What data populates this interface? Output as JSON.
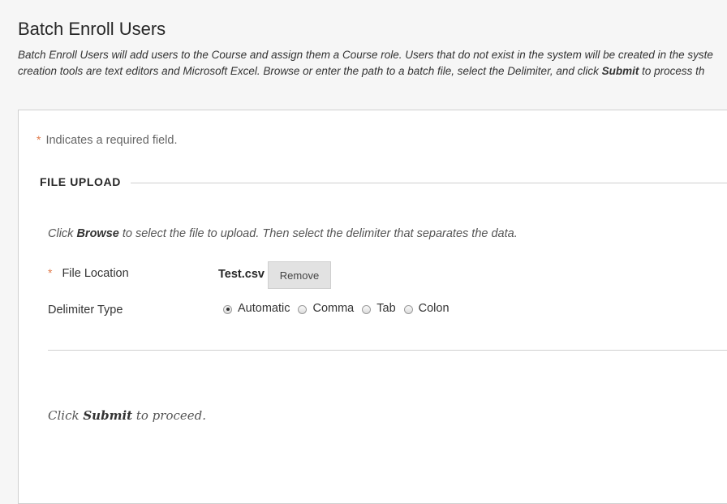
{
  "page": {
    "title": "Batch Enroll Users",
    "instructions": {
      "line1_prefix": "Batch Enroll Users will add users to the Course and assign them a Course role. Users that do not exist in the system will be created in the syste",
      "line2_prefix": "creation tools are text editors and Microsoft Excel. Browse or enter the path to a batch file, select the Delimiter, and click ",
      "line2_bold": "Submit",
      "line2_suffix": " to process th"
    }
  },
  "form": {
    "required_note": "Indicates a required field.",
    "required_star": "*",
    "section_title": "FILE UPLOAD",
    "step_instructions": {
      "prefix": "Click ",
      "bold": "Browse",
      "suffix": " to select the file to upload. Then select the delimiter that separates the data."
    },
    "file_location": {
      "label": "File Location",
      "file_name": "Test.csv",
      "remove_label": "Remove"
    },
    "delimiter": {
      "label": "Delimiter Type",
      "options": [
        "Automatic",
        "Comma",
        "Tab",
        "Colon"
      ],
      "selected": "Automatic"
    },
    "submit_instructions": {
      "prefix": "Click ",
      "bold": "Submit",
      "suffix": " to proceed."
    }
  }
}
